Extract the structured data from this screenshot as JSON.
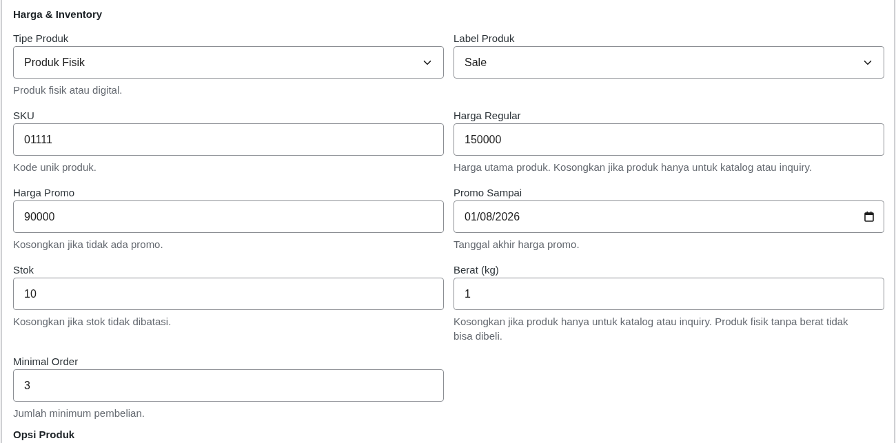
{
  "section": {
    "title": "Harga & Inventory"
  },
  "fields": [
    {
      "kind": "select",
      "label": "Tipe Produk",
      "value": "Produk Fisik",
      "help": "Produk fisik atau digital."
    },
    {
      "kind": "select",
      "label": "Label Produk",
      "value": "Sale"
    },
    {
      "kind": "text",
      "label": "SKU",
      "value": "01111",
      "help": "Kode unik produk."
    },
    {
      "kind": "text",
      "label": "Harga Regular",
      "value": "150000",
      "help": "Harga utama produk. Kosongkan jika produk hanya untuk katalog atau inquiry."
    },
    {
      "kind": "text",
      "label": "Harga Promo",
      "value": "90000",
      "help": "Kosongkan jika tidak ada promo."
    },
    {
      "kind": "date",
      "label": "Promo Sampai",
      "value": "01/08/2026",
      "help": "Tanggal akhir harga promo."
    },
    {
      "kind": "text",
      "label": "Stok",
      "value": "10",
      "help": "Kosongkan jika stok tidak dibatasi."
    },
    {
      "kind": "text",
      "label": "Berat (kg)",
      "value": "1",
      "help": "Kosongkan jika produk hanya untuk katalog atau inquiry. Produk fisik tanpa berat tidak bisa dibeli."
    },
    {
      "kind": "text",
      "label": "Minimal Order",
      "value": "3",
      "help": "Jumlah minimum pembelian."
    }
  ],
  "next_section": {
    "title": "Opsi Produk"
  }
}
